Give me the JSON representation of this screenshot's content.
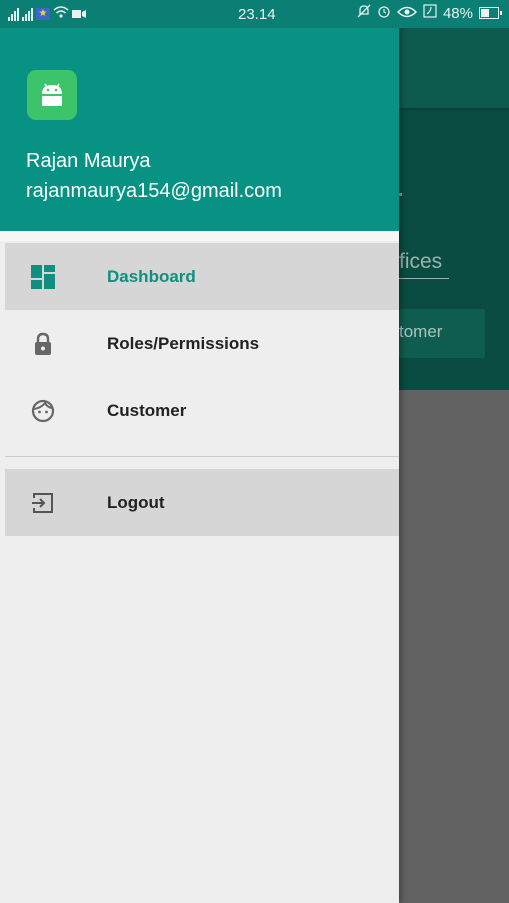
{
  "status_bar": {
    "time": "23.14",
    "battery_percent": "48%"
  },
  "background_app": {
    "field_text": "fices",
    "button_text": "tomer"
  },
  "drawer": {
    "user_name": "Rajan Maurya",
    "user_email": "rajanmaurya154@gmail.com",
    "items": [
      {
        "label": "Dashboard",
        "icon": "dashboard-icon",
        "selected": true
      },
      {
        "label": "Roles/Permissions",
        "icon": "lock-icon",
        "selected": false
      },
      {
        "label": "Customer",
        "icon": "face-icon",
        "selected": false
      }
    ],
    "logout_label": "Logout"
  },
  "colors": {
    "primary": "#079283",
    "status_bar": "#0b7f73",
    "selected_text": "#0e8f80",
    "avatar": "#3dc46a"
  }
}
